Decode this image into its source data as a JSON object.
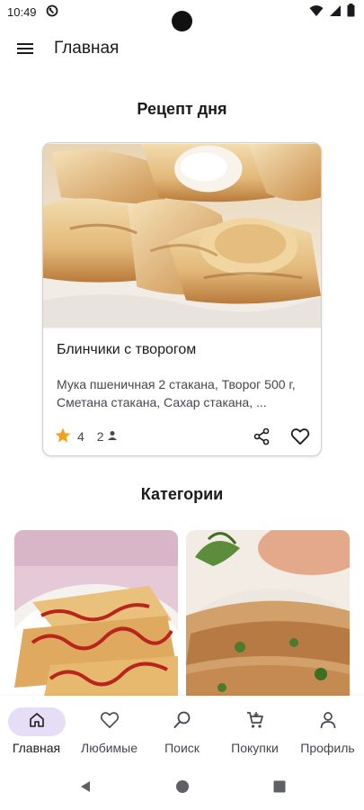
{
  "status_bar": {
    "time": "10:49"
  },
  "app_bar": {
    "title": "Главная"
  },
  "recipe_of_day": {
    "heading": "Рецепт  дня",
    "name": "Блинчики с творогом",
    "ingredients": "Мука пшеничная 2 стакана, Творог 500 г, Сметана стакана, Сахар стакана, ...",
    "rating": "4",
    "servings": "2"
  },
  "categories": {
    "heading": "Категории"
  },
  "bottom_nav": {
    "items": [
      {
        "label": "Главная",
        "icon": "home-icon",
        "active": true
      },
      {
        "label": "Любимые",
        "icon": "heart-icon",
        "active": false
      },
      {
        "label": "Поиск",
        "icon": "search-icon",
        "active": false
      },
      {
        "label": "Покупки",
        "icon": "cart-icon",
        "active": false
      },
      {
        "label": "Профиль",
        "icon": "person-icon",
        "active": false
      }
    ]
  },
  "colors": {
    "accent_active_bg": "#e5def6",
    "star": "#f2a31c",
    "text": "#1b1b1f",
    "muted": "#45464f"
  }
}
